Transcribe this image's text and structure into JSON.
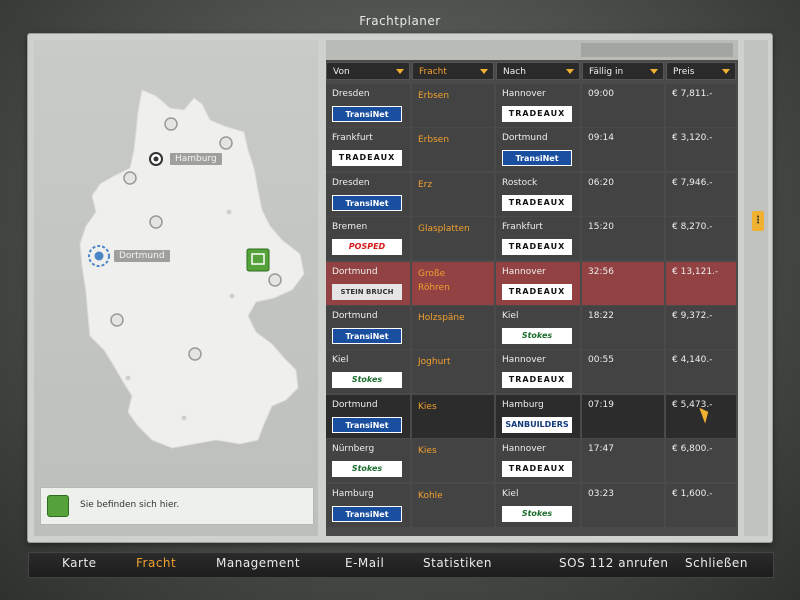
{
  "window": {
    "title": "Frachtplaner"
  },
  "map": {
    "cities": [
      {
        "name": "Hamburg"
      },
      {
        "name": "Dortmund"
      }
    ],
    "info_text": "Sie befinden sich hier."
  },
  "table": {
    "headers": [
      "Von",
      "Fracht",
      "Nach",
      "Fällig in",
      "Preis"
    ],
    "active_header": "Fracht",
    "rows": [
      {
        "from": "Dresden",
        "from_company": "TransiNet",
        "cargo": "Erbsen",
        "to": "Hannover",
        "to_company": "TRADEAUX",
        "due": "09:00",
        "price": "€ 7,811.-"
      },
      {
        "from": "Frankfurt",
        "from_company": "TRADEAUX",
        "cargo": "Erbsen",
        "to": "Dortmund",
        "to_company": "TransiNet",
        "due": "09:14",
        "price": "€ 3,120.-"
      },
      {
        "from": "Dresden",
        "from_company": "TransiNet",
        "cargo": "Erz",
        "to": "Rostock",
        "to_company": "TRADEAUX",
        "due": "06:20",
        "price": "€ 7,946.-"
      },
      {
        "from": "Bremen",
        "from_company": "POSPED",
        "cargo": "Glasplatten",
        "to": "Frankfurt",
        "to_company": "TRADEAUX",
        "due": "15:20",
        "price": "€ 8,270.-"
      },
      {
        "from": "Dortmund",
        "from_company": "STEIN BRUCH",
        "cargo": "Große Röhren",
        "to": "Hannover",
        "to_company": "TRADEAUX",
        "due": "32:56",
        "price": "€ 13,121.-"
      },
      {
        "from": "Dortmund",
        "from_company": "TransiNet",
        "cargo": "Holzspäne",
        "to": "Kiel",
        "to_company": "Stokes",
        "due": "18:22",
        "price": "€ 9,372.-"
      },
      {
        "from": "Kiel",
        "from_company": "Stokes",
        "cargo": "Joghurt",
        "to": "Hannover",
        "to_company": "TRADEAUX",
        "due": "00:55",
        "price": "€ 4,140.-"
      },
      {
        "from": "Dortmund",
        "from_company": "TransiNet",
        "cargo": "Kies",
        "to": "Hamburg",
        "to_company": "SANBUILDERS",
        "due": "07:19",
        "price": "€ 5,473.-"
      },
      {
        "from": "Nürnberg",
        "from_company": "Stokes",
        "cargo": "Kies",
        "to": "Hannover",
        "to_company": "TRADEAUX",
        "due": "17:47",
        "price": "€ 6,800.-"
      },
      {
        "from": "Hamburg",
        "from_company": "TransiNet",
        "cargo": "Kohle",
        "to": "Kiel",
        "to_company": "Stokes",
        "due": "03:23",
        "price": "€ 1,600.-"
      }
    ]
  },
  "nav": {
    "items": [
      "Karte",
      "Fracht",
      "Management",
      "E-Mail",
      "Statistiken",
      "SOS 112 anrufen",
      "Schließen"
    ],
    "active": "Fracht"
  },
  "colors": {
    "accent": "#f0a030",
    "selected_row": "#924242",
    "panel": "#cfd1cd"
  }
}
